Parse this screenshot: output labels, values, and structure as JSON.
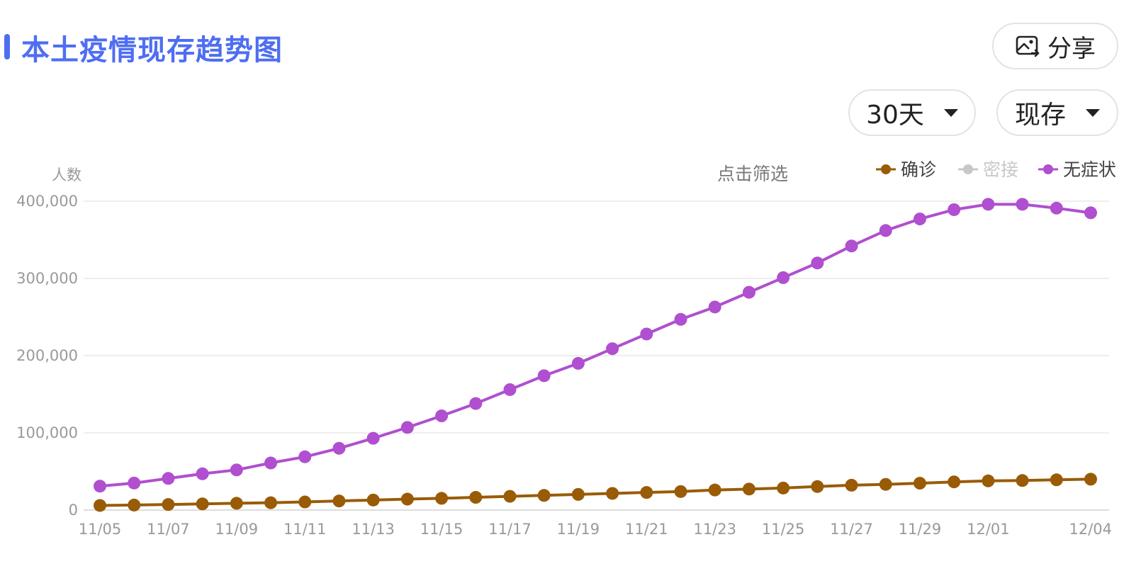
{
  "header": {
    "title": "本土疫情现存趋势图",
    "share_label": "分享",
    "range_label": "30天",
    "mode_label": "现存"
  },
  "colors": {
    "accent": "#4e6ef2",
    "confirmed": "#9a5b06",
    "close_contact": "#c8c8c8",
    "asymptomatic": "#b04fcf",
    "grid": "#eeeeee",
    "axis_text": "#999999"
  },
  "chart_data": {
    "type": "line",
    "ylabel": "人数",
    "filter_hint": "点击筛选",
    "ylim": [
      0,
      400000
    ],
    "y_ticks": [
      0,
      100000,
      200000,
      300000,
      400000
    ],
    "y_tick_labels": [
      "0",
      "100,000",
      "200,000",
      "300,000",
      "400,000"
    ],
    "x": [
      "11/05",
      "11/06",
      "11/07",
      "11/08",
      "11/09",
      "11/10",
      "11/11",
      "11/12",
      "11/13",
      "11/14",
      "11/15",
      "11/16",
      "11/17",
      "11/18",
      "11/19",
      "11/20",
      "11/21",
      "11/22",
      "11/23",
      "11/24",
      "11/25",
      "11/26",
      "11/27",
      "11/28",
      "11/29",
      "11/30",
      "12/01",
      "12/02",
      "12/03",
      "12/04"
    ],
    "x_tick_labels": [
      "11/05",
      "11/07",
      "11/09",
      "11/11",
      "11/13",
      "11/15",
      "11/17",
      "11/19",
      "11/21",
      "11/23",
      "11/25",
      "11/27",
      "11/29",
      "12/01",
      "12/04"
    ],
    "legend_position": "top-right",
    "series": [
      {
        "name": "确诊",
        "color": "#9a5b06",
        "visible": true,
        "values": [
          6000,
          6500,
          7200,
          8000,
          8800,
          9500,
          10500,
          11800,
          13000,
          14200,
          15200,
          16500,
          17800,
          19000,
          20300,
          21600,
          22800,
          24000,
          26000,
          27200,
          28500,
          30500,
          32200,
          33300,
          34800,
          36500,
          37800,
          38300,
          39200,
          40000
        ]
      },
      {
        "name": "密接",
        "color": "#c8c8c8",
        "visible": false,
        "values": []
      },
      {
        "name": "无症状",
        "color": "#b04fcf",
        "visible": true,
        "values": [
          31000,
          35000,
          41000,
          47000,
          52000,
          61000,
          69000,
          80000,
          93000,
          107000,
          122000,
          138000,
          156000,
          174000,
          190000,
          209000,
          228000,
          247000,
          263000,
          282000,
          301000,
          320000,
          342000,
          362000,
          377000,
          389000,
          396000,
          396000,
          391000,
          385000
        ]
      }
    ]
  }
}
